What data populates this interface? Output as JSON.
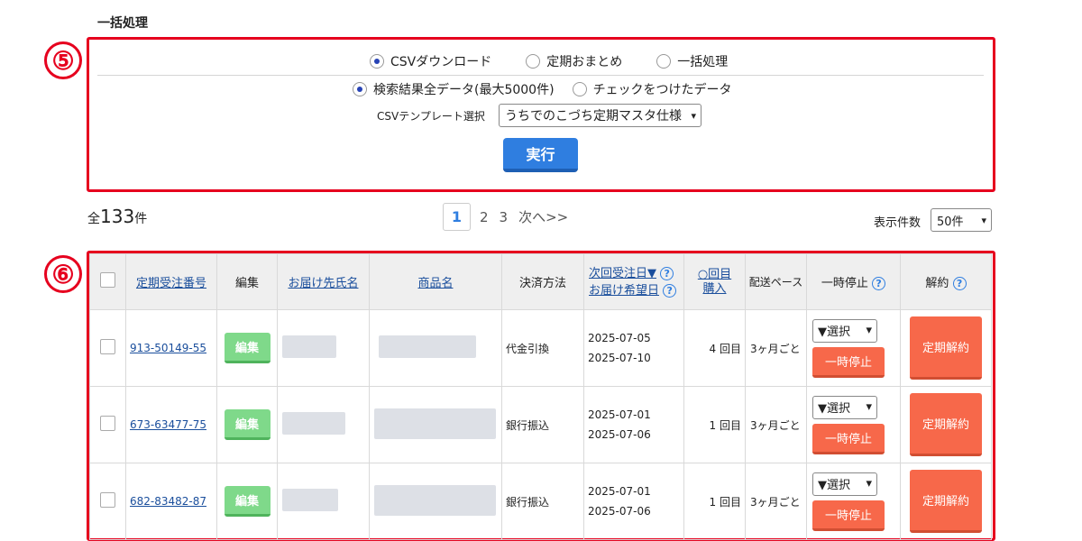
{
  "section_title": "一括処理",
  "markers": {
    "five": "⑤",
    "six": "⑥"
  },
  "mode_options": [
    {
      "label": "CSVダウンロード",
      "selected": true
    },
    {
      "label": "定期おまとめ",
      "selected": false
    },
    {
      "label": "一括処理",
      "selected": false
    }
  ],
  "target_options": [
    {
      "label": "検索結果全データ(最大5000件)",
      "selected": true
    },
    {
      "label": "チェックをつけたデータ",
      "selected": false
    }
  ],
  "template": {
    "label": "CSVテンプレート選択",
    "value": "うちでのこづち定期マスタ仕様"
  },
  "execute_label": "実行",
  "total": {
    "prefix": "全",
    "count": "133",
    "suffix": "件"
  },
  "pagination": {
    "current": "1",
    "pages": [
      "2",
      "3"
    ],
    "next": "次へ>>"
  },
  "per_page": {
    "label": "表示件数",
    "value": "50件"
  },
  "table": {
    "headers": {
      "order_no": "定期受注番号",
      "edit": "編集",
      "recipient": "お届け先氏名",
      "product": "商品名",
      "payment": "決済方法",
      "next_order": "次回受注日▼",
      "delivery_date": "お届け希望日",
      "count_top": "○回目",
      "count_bottom": "購入",
      "pace": "配送ペース",
      "pause": "一時停止",
      "cancel": "解約"
    },
    "rows": [
      {
        "order_no": "913-50149-55",
        "edit": "編集",
        "payment": "代金引換",
        "next_order": "2025-07-05",
        "delivery": "2025-07-10",
        "count": "4 回目",
        "pace": "3ヶ月ごと",
        "select": "▼選択",
        "pause": "一時停止",
        "cancel": "定期解約"
      },
      {
        "order_no": "673-63477-75",
        "edit": "編集",
        "payment": "銀行振込",
        "next_order": "2025-07-01",
        "delivery": "2025-07-06",
        "count": "1 回目",
        "pace": "3ヶ月ごと",
        "select": "▼選択",
        "pause": "一時停止",
        "cancel": "定期解約"
      },
      {
        "order_no": "682-83482-87",
        "edit": "編集",
        "payment": "銀行振込",
        "next_order": "2025-07-01",
        "delivery": "2025-07-06",
        "count": "1 回目",
        "pace": "3ヶ月ごと",
        "select": "▼選択",
        "pause": "一時停止",
        "cancel": "定期解約"
      }
    ]
  }
}
